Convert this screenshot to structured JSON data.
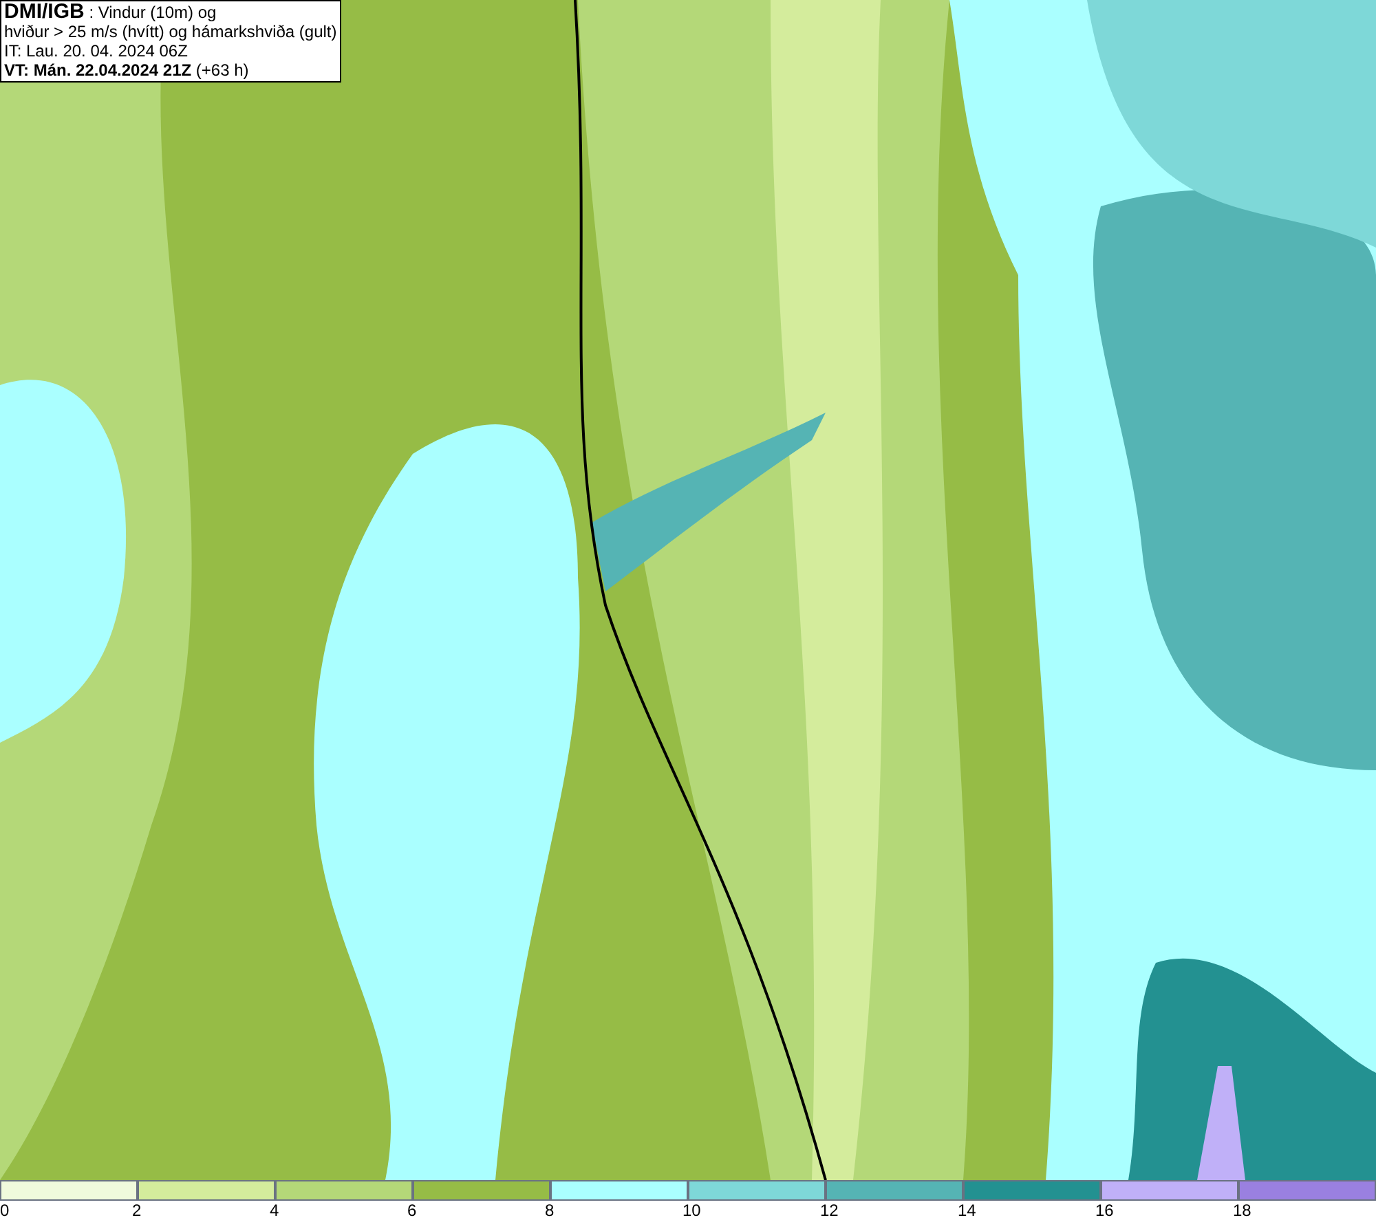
{
  "header": {
    "source": "DMI/IGB",
    "description": ": Vindur (10m) og",
    "line_2": "hviður > 25 m/s (hvítt) og hámarkshviða (gult)",
    "issue_time": "IT: Lau. 20. 04. 2024 06Z",
    "valid_time": "VT: Mán. 22.04.2024 21Z",
    "lead": "(+63 h)"
  },
  "legend": {
    "bins": [
      {
        "color": "#f0fadc",
        "label": "0"
      },
      {
        "color": "#d4ec9c",
        "label": "2"
      },
      {
        "color": "#b4d878",
        "label": "4"
      },
      {
        "color": "#96bc46",
        "label": "6"
      },
      {
        "color": "#aaffff",
        "label": "8"
      },
      {
        "color": "#7ed8d8",
        "label": "10"
      },
      {
        "color": "#55b4b4",
        "label": "12"
      },
      {
        "color": "#239191",
        "label": "14"
      },
      {
        "color": "#c0b0f8",
        "label": "16"
      },
      {
        "color": "#9a80e0",
        "label": "18"
      }
    ]
  }
}
